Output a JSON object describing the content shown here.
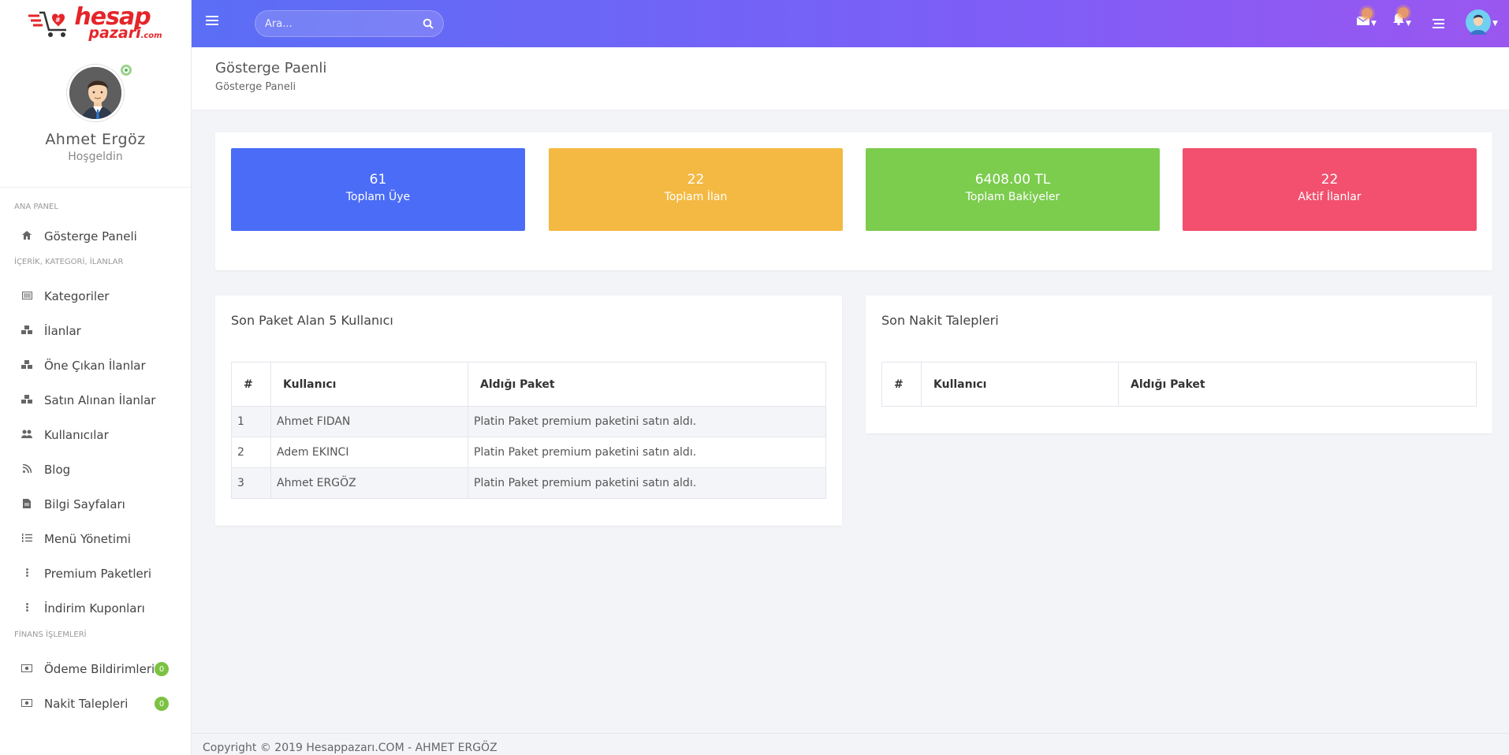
{
  "brand": {
    "logo_main": "hesap",
    "logo_sub": "pazari",
    "logo_tld": ".com"
  },
  "profile": {
    "name": "Ahmet Ergöz",
    "greeting": "Hoşgeldin"
  },
  "sidebar": {
    "sections": [
      {
        "title": "ANA PANEL",
        "items": [
          {
            "label": "Gösterge Paneli",
            "icon": "home-icon"
          }
        ]
      },
      {
        "title": "İÇERİK, KATEGORİ, İLANLAR",
        "items": [
          {
            "label": "Kategoriler",
            "icon": "list-alt-icon"
          },
          {
            "label": "İlanlar",
            "icon": "cubes-icon"
          },
          {
            "label": "Öne Çıkan İlanlar",
            "icon": "cubes-icon"
          },
          {
            "label": "Satın Alınan İlanlar",
            "icon": "cubes-icon"
          },
          {
            "label": "Kullanıcılar",
            "icon": "users-icon"
          },
          {
            "label": "Blog",
            "icon": "rss-icon"
          },
          {
            "label": "Bilgi Sayfaları",
            "icon": "file-text-icon"
          },
          {
            "label": "Menü Yönetimi",
            "icon": "list-ol-icon"
          },
          {
            "label": "Premium Paketleri",
            "icon": "ellipsis-v-icon"
          },
          {
            "label": "İndirim Kuponları",
            "icon": "ellipsis-v-icon"
          }
        ]
      },
      {
        "title": "FİNANS İŞLEMLERİ",
        "items": [
          {
            "label": "Ödeme Bildirimleri",
            "icon": "money-icon",
            "badge": "0"
          },
          {
            "label": "Nakit Talepleri",
            "icon": "money-icon",
            "badge": "0"
          }
        ]
      }
    ]
  },
  "search": {
    "placeholder": "Ara..."
  },
  "header": {
    "title": "Gösterge Paenli",
    "breadcrumb": "Gösterge Paneli"
  },
  "stats": [
    {
      "value": "61",
      "label": "Toplam Üye",
      "color": "#4a6cf7"
    },
    {
      "value": "22",
      "label": "Toplam İlan",
      "color": "#f4b942"
    },
    {
      "value": "6408.00 TL",
      "label": "Toplam Bakiyeler",
      "color": "#7ccc4e"
    },
    {
      "value": "22",
      "label": "Aktif İlanlar",
      "color": "#f2506e"
    }
  ],
  "packages_panel": {
    "title": "Son Paket Alan 5 Kullanıcı",
    "columns": [
      "#",
      "Kullanıcı",
      "Aldığı Paket"
    ],
    "rows": [
      [
        "1",
        "Ahmet FIDAN",
        "Platin Paket premium paketini satın aldı."
      ],
      [
        "2",
        "Adem EKINCI",
        "Platin Paket premium paketini satın aldı."
      ],
      [
        "3",
        "Ahmet ERGÖZ",
        "Platin Paket premium paketini satın aldı."
      ]
    ]
  },
  "cash_panel": {
    "title": "Son Nakit Talepleri",
    "columns": [
      "#",
      "Kullanıcı",
      "Aldığı Paket"
    ]
  },
  "footer": {
    "text": "Copyright © 2019 Hesappazarı.COM - AHMET ERGÖZ"
  }
}
